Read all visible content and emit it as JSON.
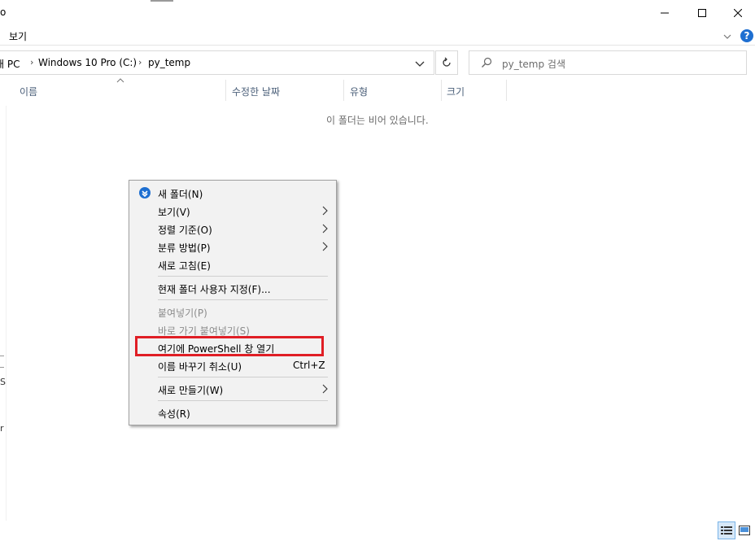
{
  "window": {
    "title_fragment": "o",
    "menu_tab": "보기"
  },
  "address": {
    "crumbs": [
      "내 PC",
      "Windows 10 Pro (C:)",
      "py_temp"
    ]
  },
  "search": {
    "placeholder": "py_temp 검색"
  },
  "columns": [
    "이름",
    "수정한 날짜",
    "유형",
    "크기"
  ],
  "empty_message": "이 폴더는 비어 있습니다.",
  "context_menu": {
    "items": [
      {
        "label": "새 폴더(N)",
        "icon": "new-folder-icon"
      },
      {
        "label": "보기(V)",
        "submenu": true
      },
      {
        "label": "정렬 기준(O)",
        "submenu": true
      },
      {
        "label": "분류 방법(P)",
        "submenu": true
      },
      {
        "label": "새로 고침(E)"
      },
      {
        "label": "현재 폴더 사용자 지정(F)..."
      },
      {
        "label": "붙여넣기(P)",
        "disabled": true
      },
      {
        "label": "바로 가기 붙여넣기(S)",
        "disabled": true
      },
      {
        "label": "여기에 PowerShell 창 열기",
        "highlighted": true,
        "highlight_color": "#e01e25"
      },
      {
        "label": "이름 바꾸기 취소(U)",
        "shortcut": "Ctrl+Z"
      },
      {
        "label": "새로 만들기(W)",
        "submenu": true
      },
      {
        "label": "속성(R)"
      }
    ]
  },
  "left_edge_fragments": [
    "S",
    "r"
  ],
  "colors": {
    "accent_blue": "#1e6fd1",
    "highlight_red": "#e01e25",
    "menu_bg": "#f2f2f2"
  }
}
